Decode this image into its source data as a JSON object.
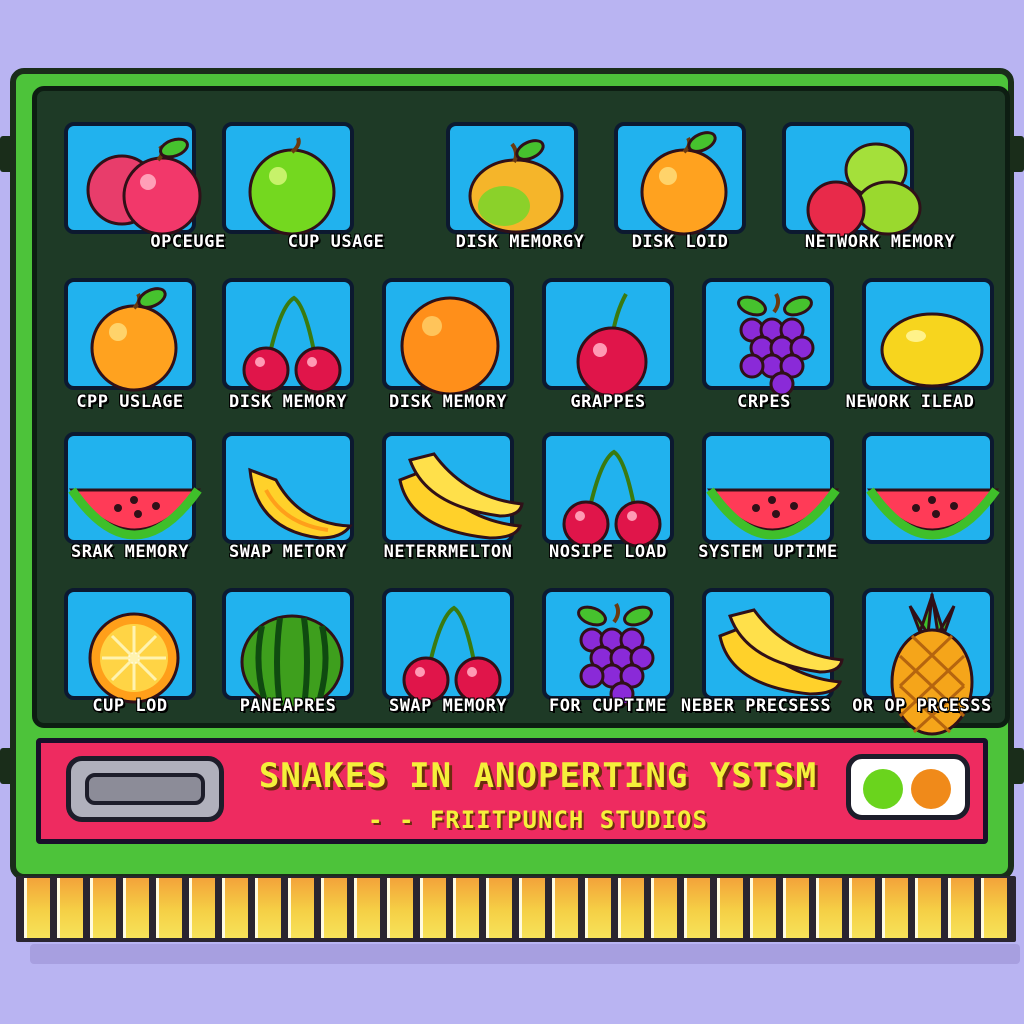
{
  "colors": {
    "background": "#b9b4f2",
    "cartridge_green": "#4dc33a",
    "screen_dark": "#1e3a26",
    "tile_blue": "#21b2ee",
    "banner_pink": "#ee2b60",
    "title_yellow": "#f5f03a",
    "led_green": "#6ad41d",
    "led_orange": "#f08a1a"
  },
  "grid": [
    {
      "fruit": "apples",
      "label": "OPCEUGE"
    },
    {
      "fruit": "green-apple",
      "label": "CUP USAGE"
    },
    {
      "fruit": "mango",
      "label": "DISK MEMORGY"
    },
    {
      "fruit": "orange-apple",
      "label": "DISK LOID"
    },
    {
      "fruit": "lime-cluster",
      "label": "NETWORK MEMORY"
    },
    {
      "fruit": "orange-apple",
      "label": "CPP USLAGE"
    },
    {
      "fruit": "cherries",
      "label": "DISK MEMORY"
    },
    {
      "fruit": "orange",
      "label": "DISK MEMORY"
    },
    {
      "fruit": "cherry",
      "label": "GRAPPES"
    },
    {
      "fruit": "grapes",
      "label": "CRPES"
    },
    {
      "fruit": "lemon",
      "label": "NEWORK ILEAD"
    },
    {
      "fruit": "watermelon-slice",
      "label": "SRAK MEMORY"
    },
    {
      "fruit": "banana",
      "label": "SWAP METORY"
    },
    {
      "fruit": "banana-bunch",
      "label": "NETERRMELTON"
    },
    {
      "fruit": "cherries",
      "label": "NOSIPE LOAD"
    },
    {
      "fruit": "watermelon-slice",
      "label": "SYSTEM UPTIME"
    },
    {
      "fruit": "watermelon-slice",
      "label": ""
    },
    {
      "fruit": "orange-half",
      "label": "CUP LOD"
    },
    {
      "fruit": "watermelon",
      "label": "PANEAPRES"
    },
    {
      "fruit": "cherries",
      "label": "SWAP MEMORY"
    },
    {
      "fruit": "grapes",
      "label": "FOR CUPTIME"
    },
    {
      "fruit": "banana-bunch",
      "label": "NEBER PRECSESS"
    },
    {
      "fruit": "pineapple",
      "label": "OR OP PRCESSS"
    }
  ],
  "banner": {
    "title": "SNAKES IN ANOPERTING YSTSM",
    "publisher": "- - FRIITPUNCH STUDIOS"
  }
}
